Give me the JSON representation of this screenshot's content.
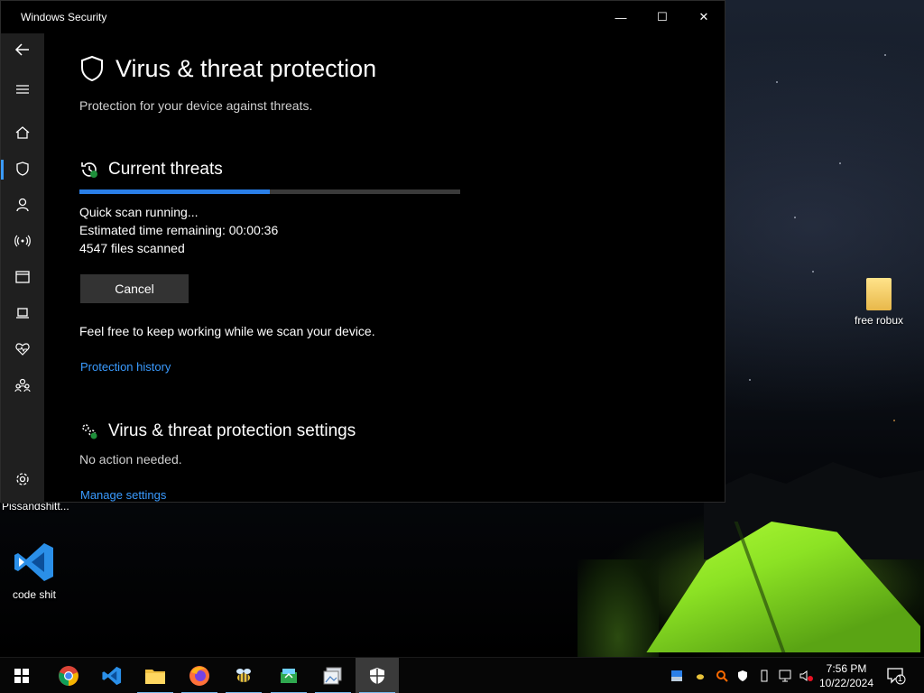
{
  "window": {
    "title": "Windows Security",
    "controls": {
      "minimize": "—",
      "maximize": "☐",
      "close": "✕"
    }
  },
  "sidebar": {
    "items": [
      {
        "name": "back",
        "icon": "back-arrow-icon"
      },
      {
        "name": "menu",
        "icon": "hamburger-icon"
      },
      {
        "name": "home",
        "icon": "home-icon"
      },
      {
        "name": "virus-protection",
        "icon": "shield-icon",
        "active": true
      },
      {
        "name": "account-protection",
        "icon": "person-icon"
      },
      {
        "name": "firewall-network",
        "icon": "wifi-antenna-icon"
      },
      {
        "name": "app-browser-control",
        "icon": "browser-window-icon"
      },
      {
        "name": "device-security",
        "icon": "laptop-icon"
      },
      {
        "name": "device-performance",
        "icon": "heart-pulse-icon"
      },
      {
        "name": "family-options",
        "icon": "family-icon"
      },
      {
        "name": "settings",
        "icon": "gear-icon"
      }
    ]
  },
  "main": {
    "title": "Virus & threat protection",
    "subtitle": "Protection for your device against threats.",
    "current_threats": {
      "heading": "Current threats",
      "progress": 0.5,
      "status": "Quick scan running...",
      "eta": "Estimated time remaining:  00:00:36",
      "files": "4547  files scanned",
      "cancel_label": "Cancel",
      "note": "Feel free to keep working while we scan your device.",
      "history_link": "Protection history"
    },
    "settings": {
      "heading": "Virus & threat protection settings",
      "status": "No action needed.",
      "manage_link": "Manage settings"
    }
  },
  "desktop": {
    "icons": [
      {
        "label": "free robux",
        "icon": "folder-icon"
      },
      {
        "label": "code shit",
        "icon": "vscode-icon"
      },
      {
        "label": "Pissandshitt...",
        "icon": "file-icon"
      }
    ]
  },
  "taskbar": {
    "apps": [
      {
        "name": "start",
        "icon": "windows-logo-icon"
      },
      {
        "name": "chrome",
        "icon": "chrome-icon"
      },
      {
        "name": "vscode",
        "icon": "vscode-icon"
      },
      {
        "name": "file-explorer",
        "icon": "folder-icon"
      },
      {
        "name": "firefox",
        "icon": "firefox-icon"
      },
      {
        "name": "app-bee",
        "icon": "bee-icon"
      },
      {
        "name": "app-green",
        "icon": "green-app-icon"
      },
      {
        "name": "app-photos",
        "icon": "photos-icon"
      },
      {
        "name": "windows-security",
        "icon": "shield-icon",
        "active": true
      }
    ],
    "clock": {
      "time": "7:56 PM",
      "date": "10/22/2024"
    },
    "notification_count": "1"
  },
  "colors": {
    "accent": "#2a7fe8",
    "link": "#3a9bff",
    "sidebar_bg": "#1f1f1f",
    "window_bg": "#000000"
  }
}
